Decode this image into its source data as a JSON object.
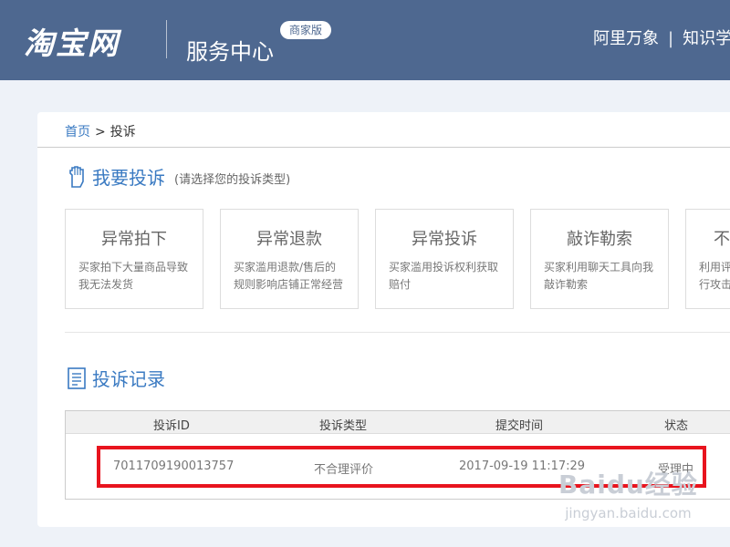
{
  "header": {
    "logo": "淘宝网",
    "title": "服务中心",
    "badge": "商家版",
    "nav": [
      "阿里万象",
      "知识学"
    ]
  },
  "breadcrumb": {
    "home": "首页",
    "separator": ">",
    "current": "投诉"
  },
  "complaint_section": {
    "title": "我要投诉",
    "hint": "(请选择您的投诉类型)",
    "cards": [
      {
        "title": "异常拍下",
        "desc": "买家拍下大量商品导致我无法发货"
      },
      {
        "title": "异常退款",
        "desc": "买家滥用退款/售后的规则影响店铺正常经营"
      },
      {
        "title": "异常投诉",
        "desc": "买家滥用投诉权利获取赔付"
      },
      {
        "title": "敲诈勒索",
        "desc": "买家利用聊天工具向我敲诈勒索"
      },
      {
        "title": "不",
        "desc": "利用评行攻击"
      }
    ]
  },
  "records_section": {
    "title": "投诉记录",
    "columns": [
      "投诉ID",
      "投诉类型",
      "提交时间",
      "状态"
    ],
    "rows": [
      {
        "id": "7011709190013757",
        "type": "不合理评价",
        "time": "2017-09-19 11:17:29",
        "status": "受理中"
      }
    ]
  },
  "watermark": {
    "main": "Baidu经验",
    "sub": "jingyan.baidu.com"
  },
  "colors": {
    "header_bg": "#4e6890",
    "accent": "#3a7ac2",
    "highlight": "#e8141e"
  }
}
